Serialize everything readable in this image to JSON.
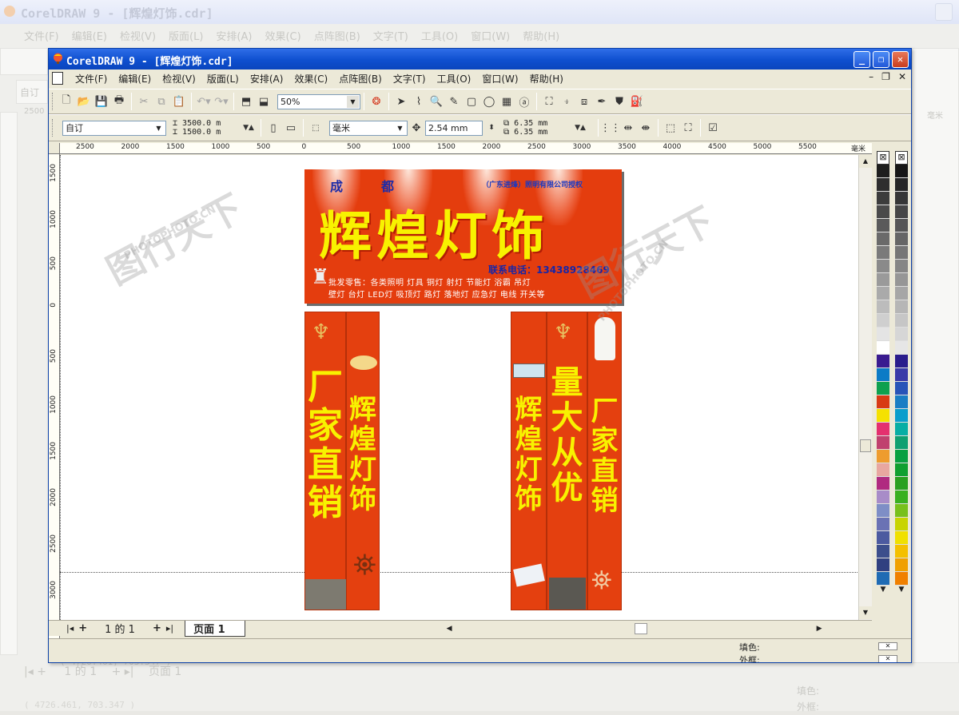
{
  "background_window": {
    "title": "CorelDRAW 9 - [辉煌灯饰.cdr]",
    "menu": [
      "文件(F)",
      "编辑(E)",
      "检视(V)",
      "版面(L)",
      "安排(A)",
      "效果(C)",
      "点阵图(B)",
      "文字(T)",
      "工具(O)",
      "窗口(W)",
      "帮助(H)"
    ],
    "zoom_value": "自订",
    "ruler_sample": "2500",
    "unit_label": "毫米",
    "status_coords": "( 4726.461, 703.347 )",
    "pager_text": "1 的 1",
    "page_tab": "页面 1",
    "fill_label": "填色:",
    "outline_label": "外框:"
  },
  "window": {
    "title": "CorelDRAW 9 - [辉煌灯饰.cdr]",
    "controls": {
      "minimize": "_",
      "restore": "❐",
      "close": "✕"
    }
  },
  "menubar": {
    "items": [
      "文件(F)",
      "编辑(E)",
      "检视(V)",
      "版面(L)",
      "安排(A)",
      "效果(C)",
      "点阵图(B)",
      "文字(T)",
      "工具(O)",
      "窗口(W)",
      "帮助(H)"
    ],
    "mdi_controls": [
      "–",
      "❐",
      "✕"
    ]
  },
  "toolbar1": {
    "zoom": "50%"
  },
  "toolbar2": {
    "paper_type": "自订",
    "width": "3500.0 m",
    "height": "1500.0 m",
    "units": "毫米",
    "nudge": "2.54 mm",
    "dup_x": "6.35 mm",
    "dup_y": "6.35 mm"
  },
  "ruler_h": {
    "labels": [
      "2500",
      "2000",
      "1500",
      "1000",
      "500",
      "0",
      "500",
      "1000",
      "1500",
      "2000",
      "2500",
      "3000",
      "3500",
      "4000",
      "4500",
      "5000",
      "5500"
    ],
    "unit": "毫米"
  },
  "ruler_v": {
    "labels": [
      "1500",
      "1000",
      "500",
      "0",
      "500",
      "1000",
      "1500",
      "2000",
      "2500",
      "3000"
    ]
  },
  "artwork": {
    "banner": {
      "city": "成都",
      "authorized": "（广东进烽）照明有限公司授权",
      "title": "辉煌灯饰",
      "phone": "联系电话：13438928469",
      "products_line1": "批发零售：各类照明  灯具  铜灯  射灯  节能灯   浴霸   吊灯",
      "products_line2": "壁灯 台灯  LED灯 吸顶灯  路灯  落地灯  应急灯 电线 开关等"
    },
    "left_pillar_a": "厂家直销",
    "left_pillar_b": "辉煌灯饰",
    "right_pillar_a": "辉煌灯饰",
    "right_pillar_b": "量大从优",
    "right_pillar_c": "厂家直销"
  },
  "pager": {
    "text": "1 的 1",
    "page_tab": "页面 1"
  },
  "status": {
    "fill_label": "填色:",
    "outline_label": "外框:"
  },
  "watermark": {
    "brand": "图行天下",
    "url": "PHOTOPHOTO.CN"
  },
  "colors": {
    "title_blue": "#0e4fcf",
    "banner_red": "#e43d0e",
    "banner_yellow": "#f8f200"
  },
  "palette_left": [
    "#1e1e1e",
    "#2e2e2e",
    "#3c3c3c",
    "#4a4a4a",
    "#5a5a5a",
    "#6a6a6a",
    "#7a7a7a",
    "#8a8a8a",
    "#9a9a9a",
    "#aaaaaa",
    "#bcbcbc",
    "#cfcfcf",
    "#e4e4e4",
    "#ffffff",
    "#3a1c90",
    "#0c7bc6",
    "#0ea04f",
    "#d83a14",
    "#f5e100",
    "#e4306f",
    "#c0416f",
    "#ee9c2e",
    "#e8a7a0",
    "#b02a80",
    "#a88cc8",
    "#7e8ec6",
    "#6a72b4",
    "#4c5aa0",
    "#3c4e8c",
    "#304080",
    "#1f6bb4"
  ],
  "palette_right": [
    "#161616",
    "#262626",
    "#363636",
    "#464646",
    "#565656",
    "#666666",
    "#767676",
    "#868686",
    "#969696",
    "#a6a6a6",
    "#b6b6b6",
    "#c6c6c6",
    "#d6d6d6",
    "#e6e6e6",
    "#2a1c8c",
    "#3a3aa8",
    "#2854b8",
    "#1a7ec4",
    "#0a9ecc",
    "#08aea4",
    "#10a070",
    "#08a040",
    "#10a030",
    "#2aa020",
    "#3ab020",
    "#78c01c",
    "#c8d400",
    "#f0e000",
    "#f4c000",
    "#f0a000",
    "#f08000"
  ]
}
